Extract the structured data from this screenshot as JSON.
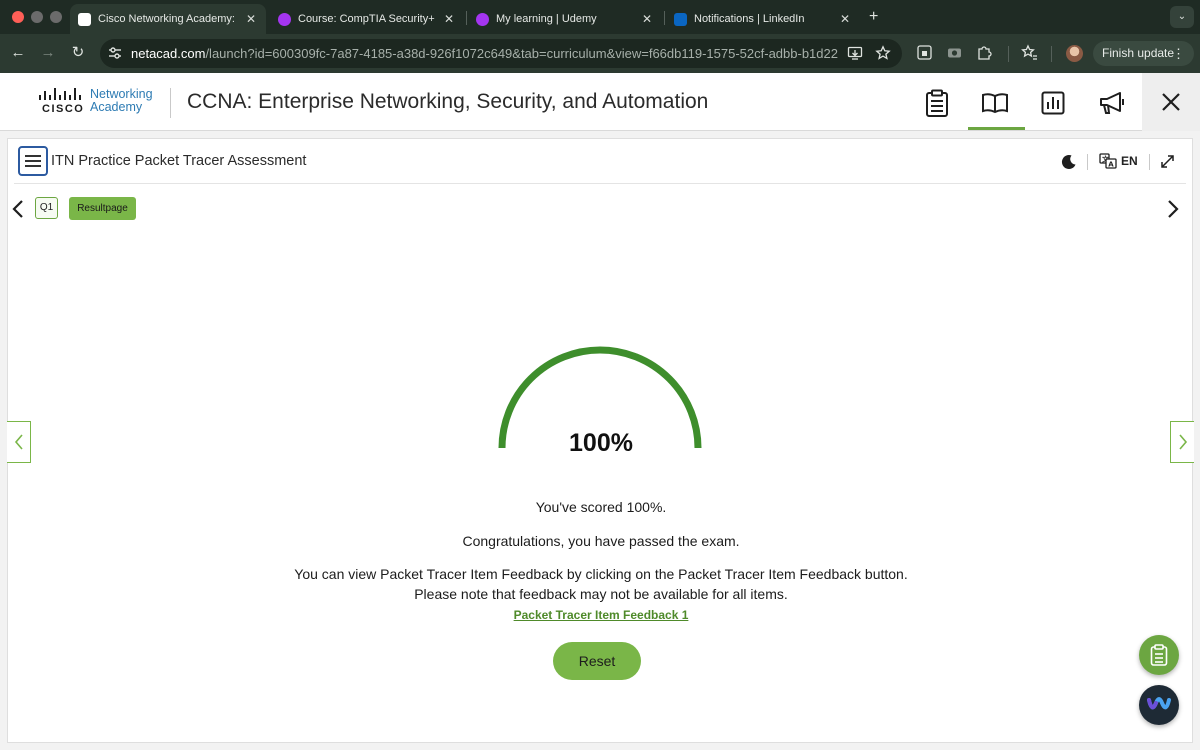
{
  "browser": {
    "tabs": [
      {
        "title": "Cisco Networking Academy: C",
        "favicon": "cisco-favicon",
        "active": true
      },
      {
        "title": "Course: CompTIA Security+ (S",
        "favicon": "udemy-favicon",
        "active": false
      },
      {
        "title": "My learning | Udemy",
        "favicon": "udemy-favicon",
        "active": false
      },
      {
        "title": "Notifications | LinkedIn",
        "favicon": "linkedin-favicon",
        "active": false
      }
    ],
    "url_host": "netacad.com",
    "url_rest": "/launch?id=600309fc-7a87-4185-a38d-926f1072c649&tab=curriculum&view=f66db119-1575-52cf-adbb-b1d22...",
    "finish_update_label": "Finish update"
  },
  "app_header": {
    "logo_cisco": "CISCO",
    "logo_line1": "Networking",
    "logo_line2": "Academy",
    "course_title": "CCNA: Enterprise Networking, Security, and Automation",
    "icons": [
      "clipboard-icon",
      "book-icon",
      "chart-icon",
      "megaphone-icon",
      "close-icon"
    ],
    "active_icon": "book-icon",
    "accent_color": "#6ca641"
  },
  "toolbar": {
    "assessment_title": "ITN Practice Packet Tracer Assessment",
    "language": "EN"
  },
  "question_nav": {
    "question_label": "Q1",
    "result_label": "Resultpage"
  },
  "result": {
    "score_percent": 100,
    "score_label": "100%",
    "scored_text": "You've scored 100%.",
    "congrats_text": "Congratulations, you have passed the exam.",
    "feedback_info_line1": "You can view Packet Tracer Item Feedback by clicking on the Packet Tracer Item Feedback button.",
    "feedback_info_line2": "Please note that feedback may not be available for all items.",
    "feedback_link": "Packet Tracer Item Feedback 1",
    "reset_label": "Reset",
    "gauge_color": "#3e8e2c"
  }
}
